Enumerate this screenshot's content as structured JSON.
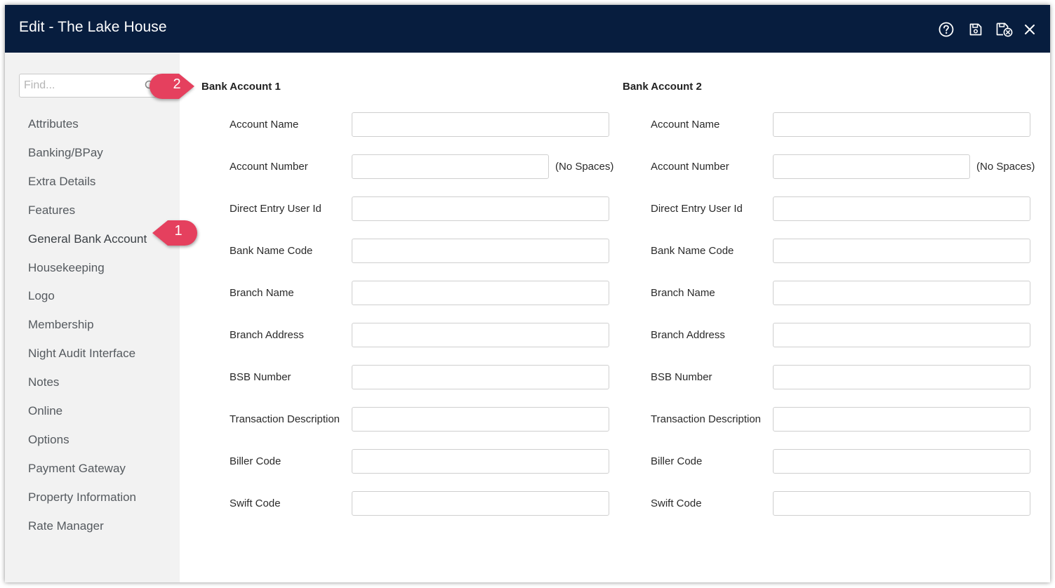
{
  "window": {
    "title": "Edit - The Lake House"
  },
  "toolbar": {
    "icons": [
      "help-icon",
      "save-icon",
      "save-close-icon",
      "close-icon"
    ]
  },
  "sidebar": {
    "search_placeholder": "Find...",
    "items": [
      {
        "label": "Attributes"
      },
      {
        "label": "Banking/BPay"
      },
      {
        "label": "Extra Details"
      },
      {
        "label": "Features"
      },
      {
        "label": "General Bank Account"
      },
      {
        "label": "Housekeeping"
      },
      {
        "label": "Logo"
      },
      {
        "label": "Membership"
      },
      {
        "label": "Night Audit Interface"
      },
      {
        "label": "Notes"
      },
      {
        "label": "Online"
      },
      {
        "label": "Options"
      },
      {
        "label": "Payment Gateway"
      },
      {
        "label": "Property Information"
      },
      {
        "label": "Rate Manager"
      }
    ],
    "active_item": "General Bank Account"
  },
  "accounts": [
    {
      "title": "Bank Account 1",
      "fields": [
        {
          "label": "Account Name",
          "value": ""
        },
        {
          "label": "Account Number",
          "value": "",
          "hint": "(No Spaces)"
        },
        {
          "label": "Direct Entry User Id",
          "value": ""
        },
        {
          "label": "Bank Name Code",
          "value": ""
        },
        {
          "label": "Branch Name",
          "value": ""
        },
        {
          "label": "Branch Address",
          "value": ""
        },
        {
          "label": "BSB Number",
          "value": ""
        },
        {
          "label": "Transaction Description",
          "value": ""
        },
        {
          "label": "Biller Code",
          "value": ""
        },
        {
          "label": "Swift Code",
          "value": ""
        }
      ]
    },
    {
      "title": "Bank Account 2",
      "fields": [
        {
          "label": "Account Name",
          "value": ""
        },
        {
          "label": "Account Number",
          "value": "",
          "hint": "(No Spaces)"
        },
        {
          "label": "Direct Entry User Id",
          "value": ""
        },
        {
          "label": "Bank Name Code",
          "value": ""
        },
        {
          "label": "Branch Name",
          "value": ""
        },
        {
          "label": "Branch Address",
          "value": ""
        },
        {
          "label": "BSB Number",
          "value": ""
        },
        {
          "label": "Transaction Description",
          "value": ""
        },
        {
          "label": "Biller Code",
          "value": ""
        },
        {
          "label": "Swift Code",
          "value": ""
        }
      ]
    }
  ],
  "callouts": [
    {
      "number": "1"
    },
    {
      "number": "2"
    }
  ],
  "colors": {
    "titlebar_bg": "#071d3e",
    "sidebar_bg": "#f2f2f2",
    "callout": "#e5405e"
  }
}
